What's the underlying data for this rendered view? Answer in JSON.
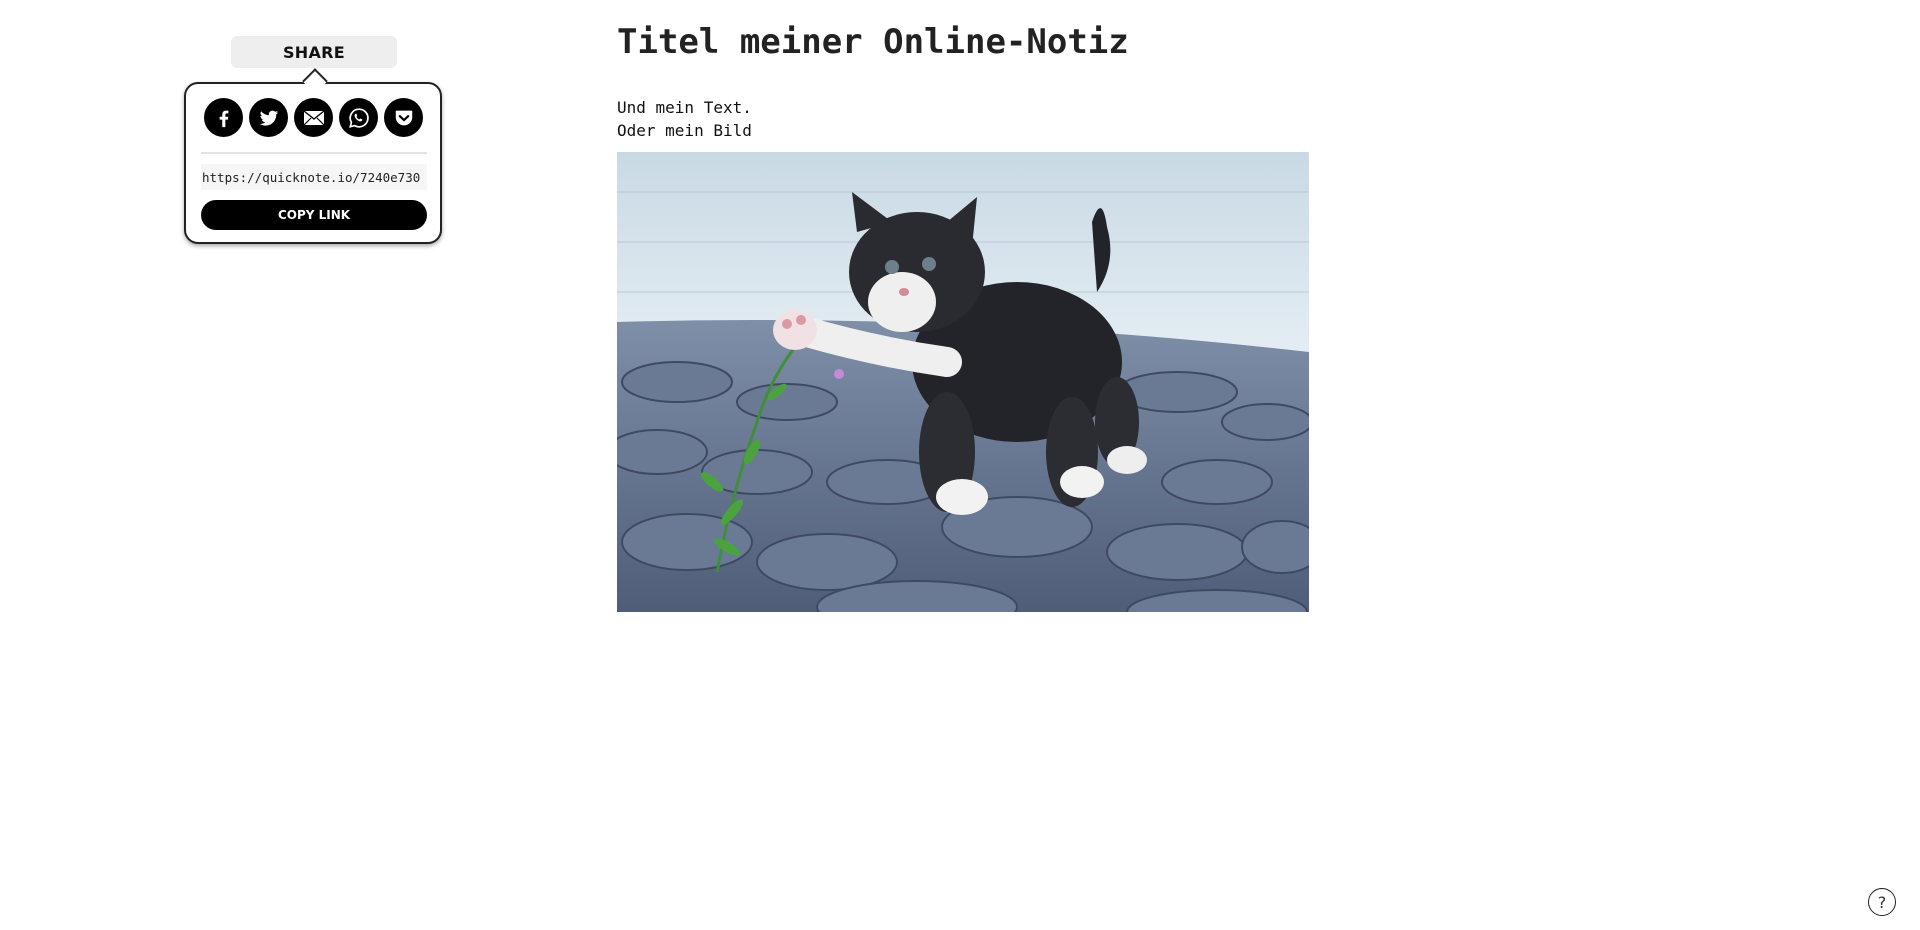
{
  "share": {
    "label": "SHARE",
    "icons": [
      "facebook-icon",
      "twitter-icon",
      "email-icon",
      "whatsapp-icon",
      "pocket-icon"
    ],
    "link_value": "https://quicknote.io/7240e730",
    "copy_label": "COPY LINK"
  },
  "note": {
    "title": "Titel meiner Online-Notiz",
    "lines": [
      "Und mein Text.",
      "Oder mein Bild"
    ],
    "image": "kitten-photo"
  },
  "help": {
    "label": "?"
  },
  "colors": {
    "accent": "#000000",
    "tab_background": "#eeeeee",
    "page_background": "#ffffff"
  }
}
